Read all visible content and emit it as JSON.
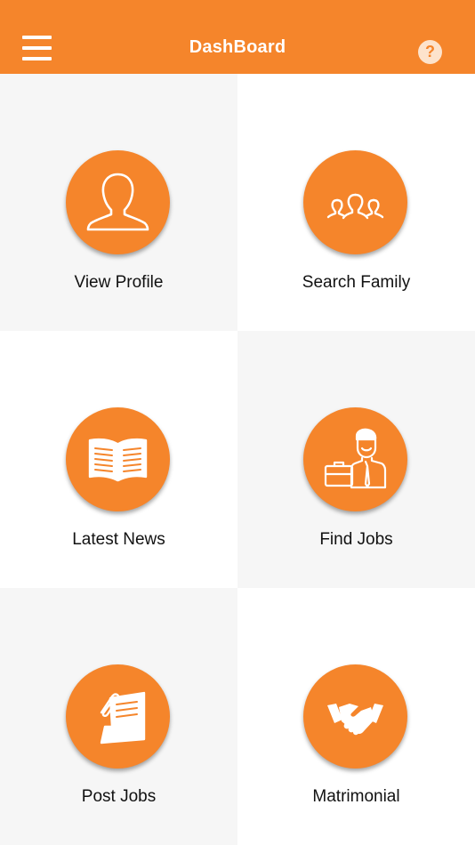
{
  "header": {
    "title": "DashBoard",
    "help_symbol": "?",
    "menu_icon": "hamburger-menu-icon",
    "help_icon": "question-mark-icon"
  },
  "colors": {
    "accent": "#f5852b",
    "tile_gray": "#f6f6f6",
    "tile_white": "#ffffff"
  },
  "tiles": [
    {
      "label": "View Profile",
      "icon": "user-profile-icon"
    },
    {
      "label": "Search Family",
      "icon": "group-people-icon"
    },
    {
      "label": "Latest News",
      "icon": "open-book-icon"
    },
    {
      "label": "Find Jobs",
      "icon": "businessman-briefcase-icon"
    },
    {
      "label": "Post Jobs",
      "icon": "document-clip-icon"
    },
    {
      "label": "Matrimonial",
      "icon": "handshake-icon"
    }
  ]
}
